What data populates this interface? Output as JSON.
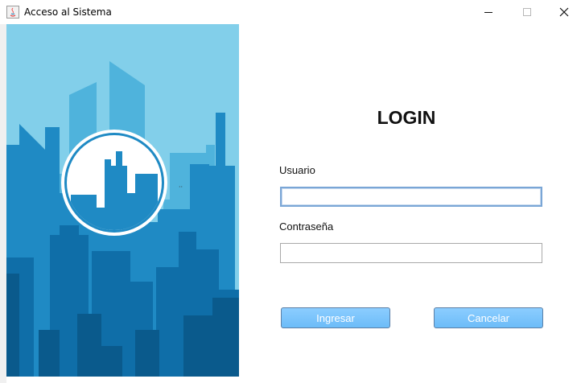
{
  "window": {
    "title": "Acceso al Sistema",
    "minimize_icon": "minimize-icon",
    "maximize_icon": "maximize-icon",
    "close_icon": "close-icon"
  },
  "illustration": {
    "sky_color": "#82cfea",
    "building_colors": [
      "#4fb3dc",
      "#1f8ac4",
      "#0f6ea8",
      "#0a5a8c"
    ]
  },
  "login": {
    "heading": "LOGIN",
    "username_label": "Usuario",
    "username_value": "",
    "password_label": "Contraseña",
    "password_value": "",
    "submit_label": "Ingresar",
    "cancel_label": "Cancelar",
    "button_color": "#7cc4fa"
  }
}
